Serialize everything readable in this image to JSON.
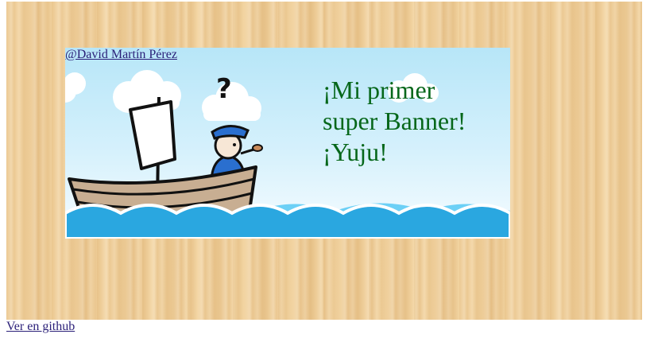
{
  "author_link": "@David Martín Pérez",
  "banner": {
    "lines": [
      "¡Mi primer",
      "super Banner!",
      "¡Yuju!"
    ],
    "question_mark": "?"
  },
  "github_link": "Ver en github",
  "colors": {
    "wood": "#f1d19c",
    "sky": "#b7e6f8",
    "banner_text": "#06671a",
    "link": "#2a1f78",
    "sea": "#2aa7e0"
  }
}
